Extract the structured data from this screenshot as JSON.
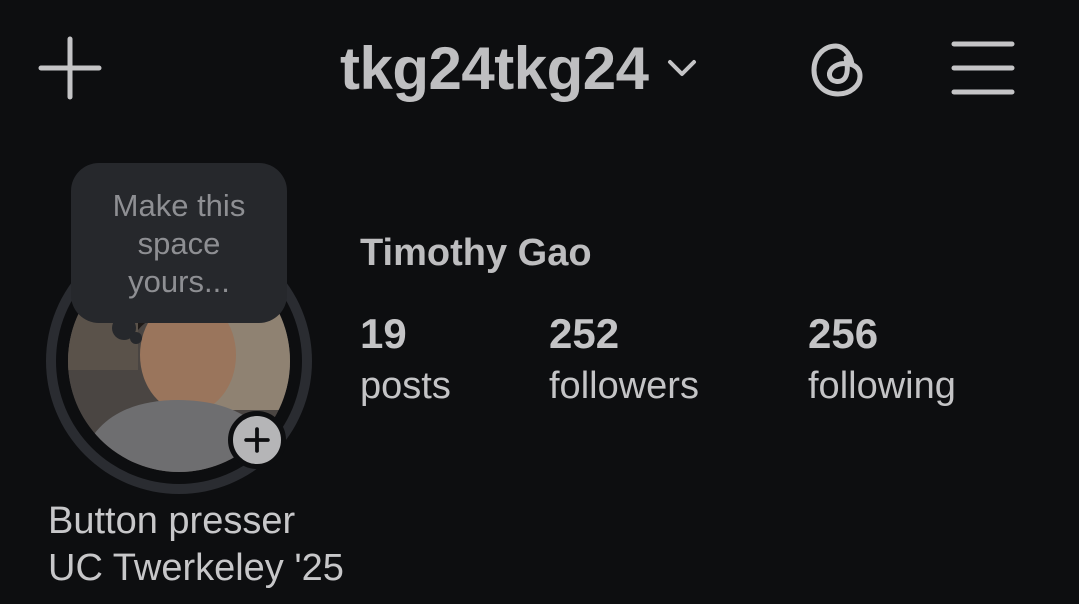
{
  "header": {
    "username": "tkg24tkg24",
    "icons": [
      "plus-icon",
      "chevron-down-icon",
      "threads-icon",
      "menu-icon"
    ]
  },
  "note": {
    "text": "Make this\nspace\nyours..."
  },
  "profile": {
    "full_name": "Timothy Gao",
    "stats": [
      {
        "value": "19",
        "label": "posts"
      },
      {
        "value": "252",
        "label": "followers"
      },
      {
        "value": "256",
        "label": "following"
      }
    ],
    "bio_lines": [
      "Button presser",
      "UC Twerkeley '25"
    ]
  },
  "colors": {
    "background": "#0d0e10",
    "text": "#c7c7c9",
    "bubble": "#26282c"
  }
}
